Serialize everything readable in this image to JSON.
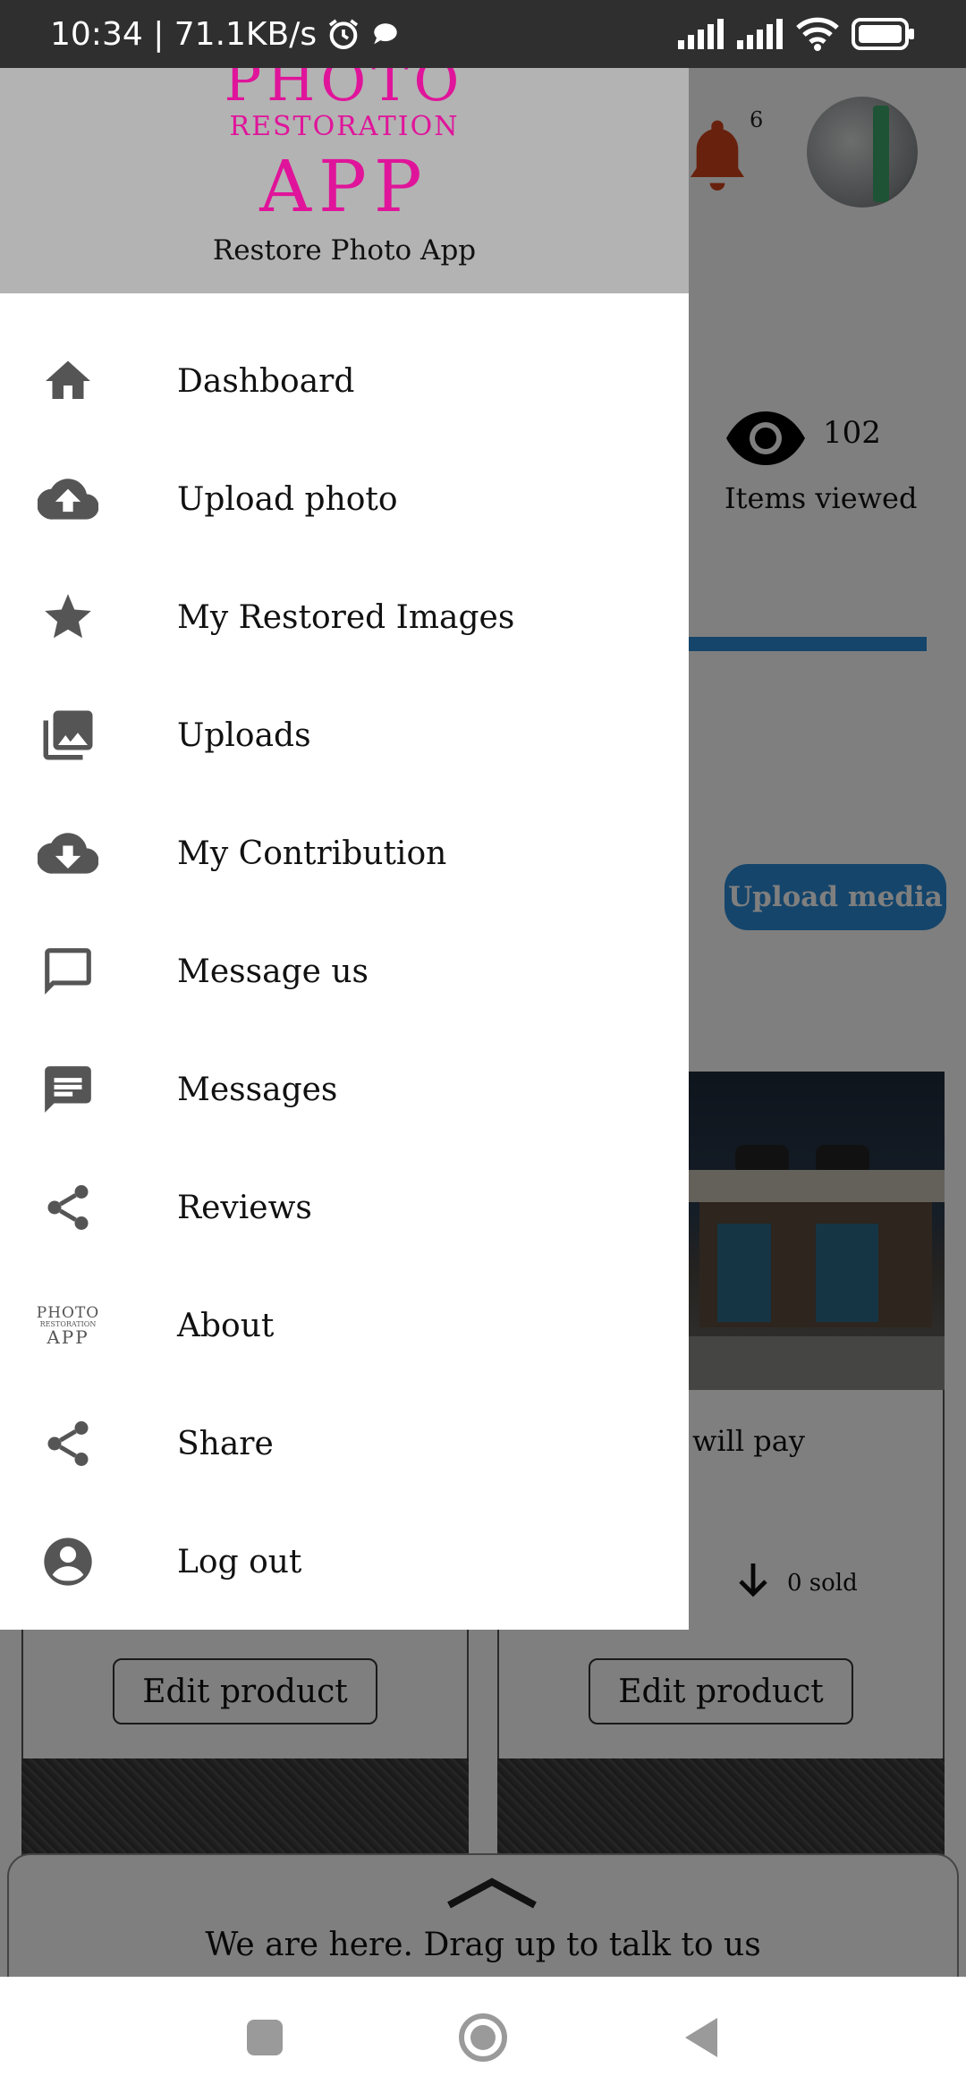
{
  "status_bar": {
    "time_speed": "10:34 | 71.1KB/s",
    "icons": [
      "alarm-icon",
      "chat-bubble-icon",
      "signal-icon",
      "signal-icon",
      "wifi-icon",
      "battery-icon"
    ]
  },
  "background": {
    "notification_count": "6",
    "views_count": "102",
    "views_label": "Items viewed",
    "upload_media_label": "Upload media",
    "product_text": "will pay",
    "sold_text": "0 sold",
    "edit_product_label": "Edit product",
    "chat_prompt": "We are here. Drag up to talk to us",
    "colors": {
      "accent": "#2a8ad6",
      "bell": "#d0431a"
    }
  },
  "drawer": {
    "logo": {
      "line1": "PHOTO",
      "line2": "RESTORATION",
      "line3": "APP",
      "color": "#e0149a"
    },
    "app_name": "Restore Photo App",
    "items": [
      {
        "label": "Dashboard",
        "icon": "home-icon"
      },
      {
        "label": "Upload photo",
        "icon": "cloud-upload-icon"
      },
      {
        "label": "My Restored Images",
        "icon": "star-icon"
      },
      {
        "label": "Uploads",
        "icon": "photo-library-icon"
      },
      {
        "label": "My Contribution",
        "icon": "cloud-download-icon"
      },
      {
        "label": "Message us",
        "icon": "chat-outline-icon"
      },
      {
        "label": "Messages",
        "icon": "message-icon"
      },
      {
        "label": "Reviews",
        "icon": "share-icon"
      },
      {
        "label": "About",
        "icon": "app-logo-icon"
      },
      {
        "label": "Share",
        "icon": "share-icon"
      },
      {
        "label": "Log out",
        "icon": "account-circle-icon"
      }
    ]
  },
  "about_logo": {
    "line1": "PHOTO",
    "line2": "RESTORATION",
    "line3": "APP"
  }
}
